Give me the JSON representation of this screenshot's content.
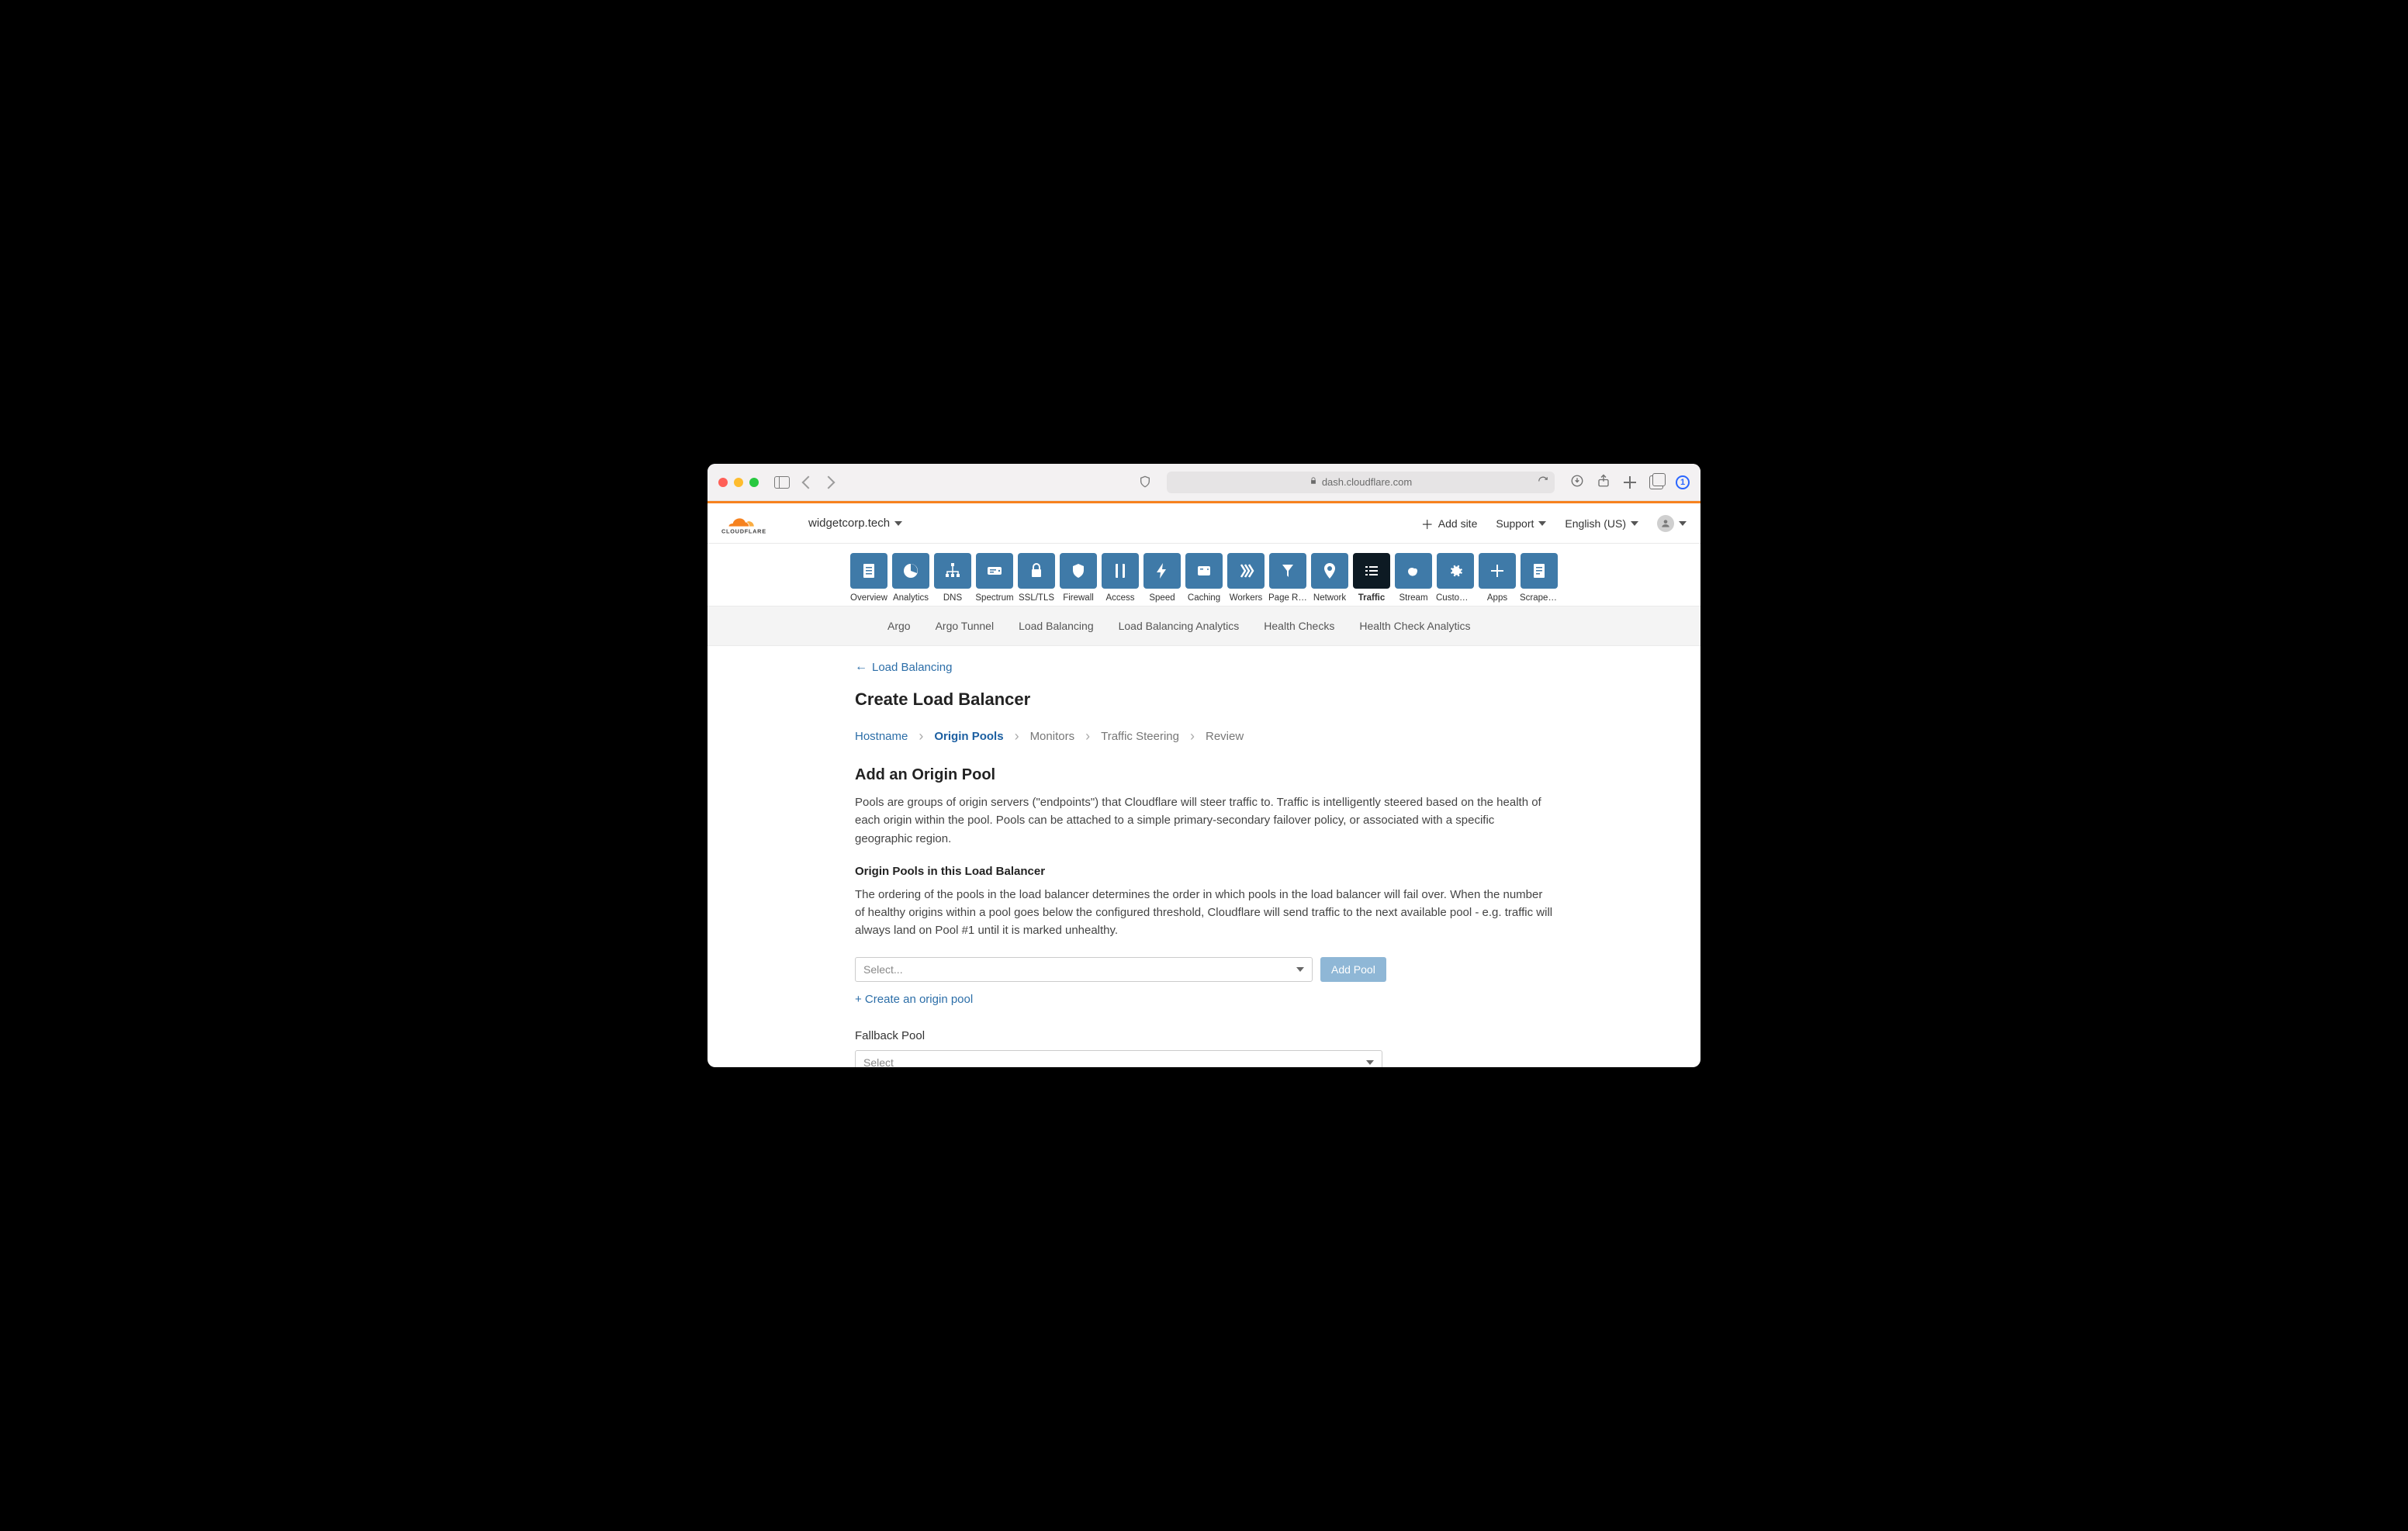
{
  "browser": {
    "url_host": "dash.cloudflare.com",
    "onepassword_label": "1"
  },
  "header": {
    "brand_text": "CLOUDFLARE",
    "zone": "widgetcorp.tech",
    "add_site": "Add site",
    "support": "Support",
    "language": "English (US)"
  },
  "nav_tiles": [
    {
      "key": "overview",
      "label": "Overview"
    },
    {
      "key": "analytics",
      "label": "Analytics"
    },
    {
      "key": "dns",
      "label": "DNS"
    },
    {
      "key": "spectrum",
      "label": "Spectrum"
    },
    {
      "key": "ssltls",
      "label": "SSL/TLS"
    },
    {
      "key": "firewall",
      "label": "Firewall"
    },
    {
      "key": "access",
      "label": "Access"
    },
    {
      "key": "speed",
      "label": "Speed"
    },
    {
      "key": "caching",
      "label": "Caching"
    },
    {
      "key": "workers",
      "label": "Workers"
    },
    {
      "key": "pagerules",
      "label": "Page Rules"
    },
    {
      "key": "network",
      "label": "Network"
    },
    {
      "key": "traffic",
      "label": "Traffic",
      "active": true
    },
    {
      "key": "stream",
      "label": "Stream"
    },
    {
      "key": "customp",
      "label": "Custom P..."
    },
    {
      "key": "apps",
      "label": "Apps"
    },
    {
      "key": "scrapes",
      "label": "Scrape S..."
    }
  ],
  "subnav": [
    "Argo",
    "Argo Tunnel",
    "Load Balancing",
    "Load Balancing Analytics",
    "Health Checks",
    "Health Check Analytics"
  ],
  "back_link": "Load Balancing",
  "page_title": "Create Load Balancer",
  "steps": [
    {
      "label": "Hostname",
      "state": "link"
    },
    {
      "label": "Origin Pools",
      "state": "current"
    },
    {
      "label": "Monitors",
      "state": "normal"
    },
    {
      "label": "Traffic Steering",
      "state": "normal"
    },
    {
      "label": "Review",
      "state": "normal"
    }
  ],
  "section": {
    "heading": "Add an Origin Pool",
    "body1": "Pools are groups of origin servers (\"endpoints\") that Cloudflare will steer traffic to. Traffic is intelligently steered based on the health of each origin within the pool. Pools can be attached to a simple primary-secondary failover policy, or associated with a specific geographic region.",
    "subhead": "Origin Pools in this Load Balancer",
    "body2": "The ordering of the pools in the load balancer determines the order in which pools in the load balancer will fail over. When the number of healthy origins within a pool goes below the configured threshold, Cloudflare will send traffic to the next available pool - e.g. traffic will always land on Pool #1 until it is marked unhealthy.",
    "select_placeholder": "Select...",
    "add_pool_button": "Add Pool",
    "create_link": "+ Create an origin pool",
    "fallback_label": "Fallback Pool",
    "fallback_placeholder": "Select"
  }
}
